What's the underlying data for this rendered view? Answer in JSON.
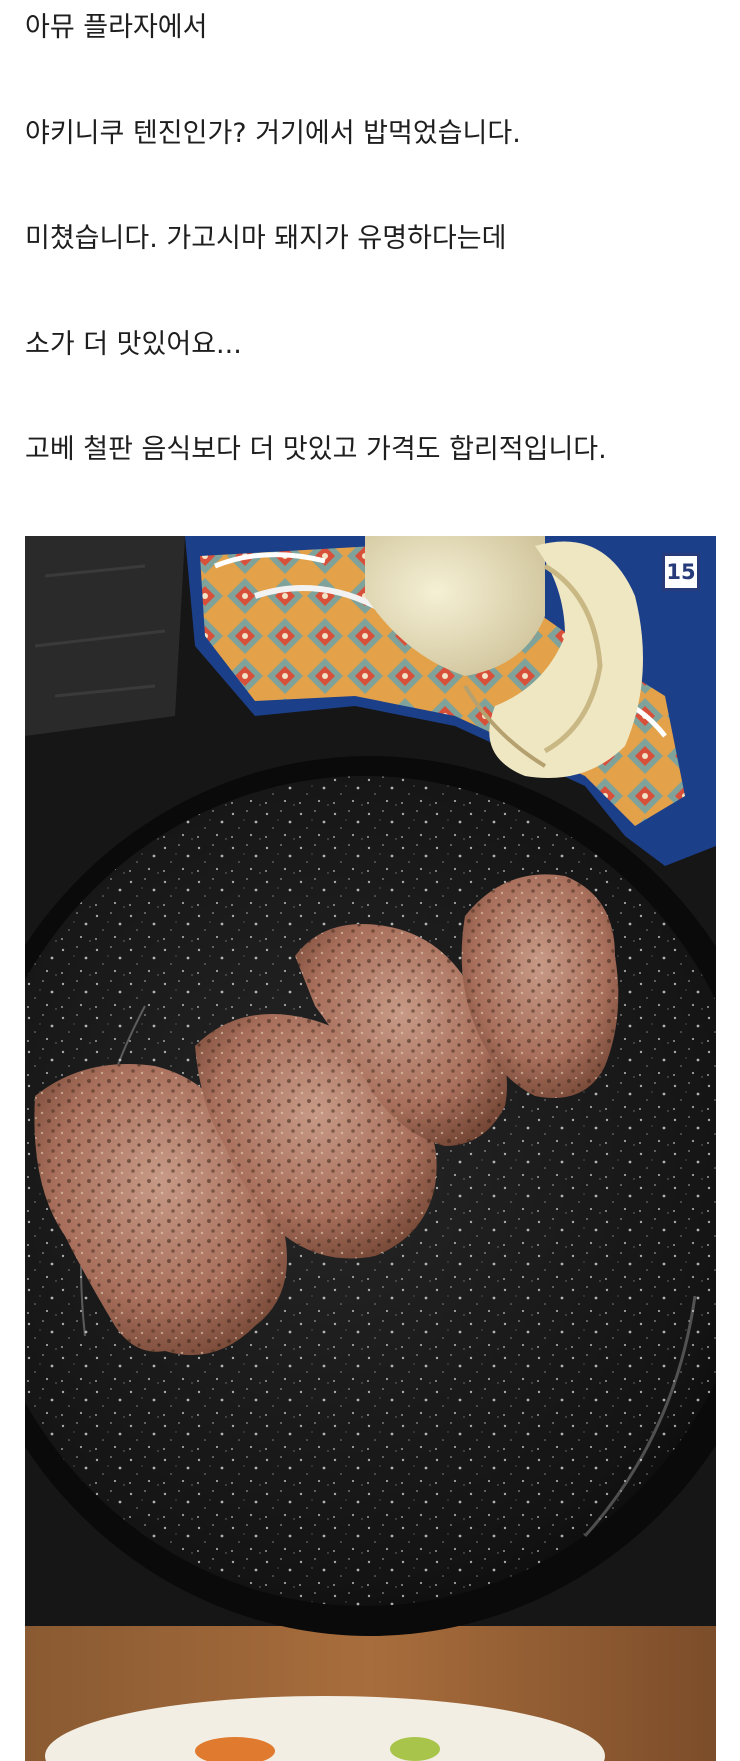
{
  "post": {
    "paragraphs": [
      "아뮤 플라자에서",
      "야키니쿠 텐진인가? 거기에서 밥먹었습니다.",
      "미쳤습니다. 가고시마 돼지가 유명하다는데",
      "소가 더 맛있어요...",
      "고베 철판 음식보다 더 맛있고 가격도 합리적입니다."
    ],
    "image": {
      "badge": "15",
      "subject": "grilled-meat-on-black-plate"
    }
  }
}
